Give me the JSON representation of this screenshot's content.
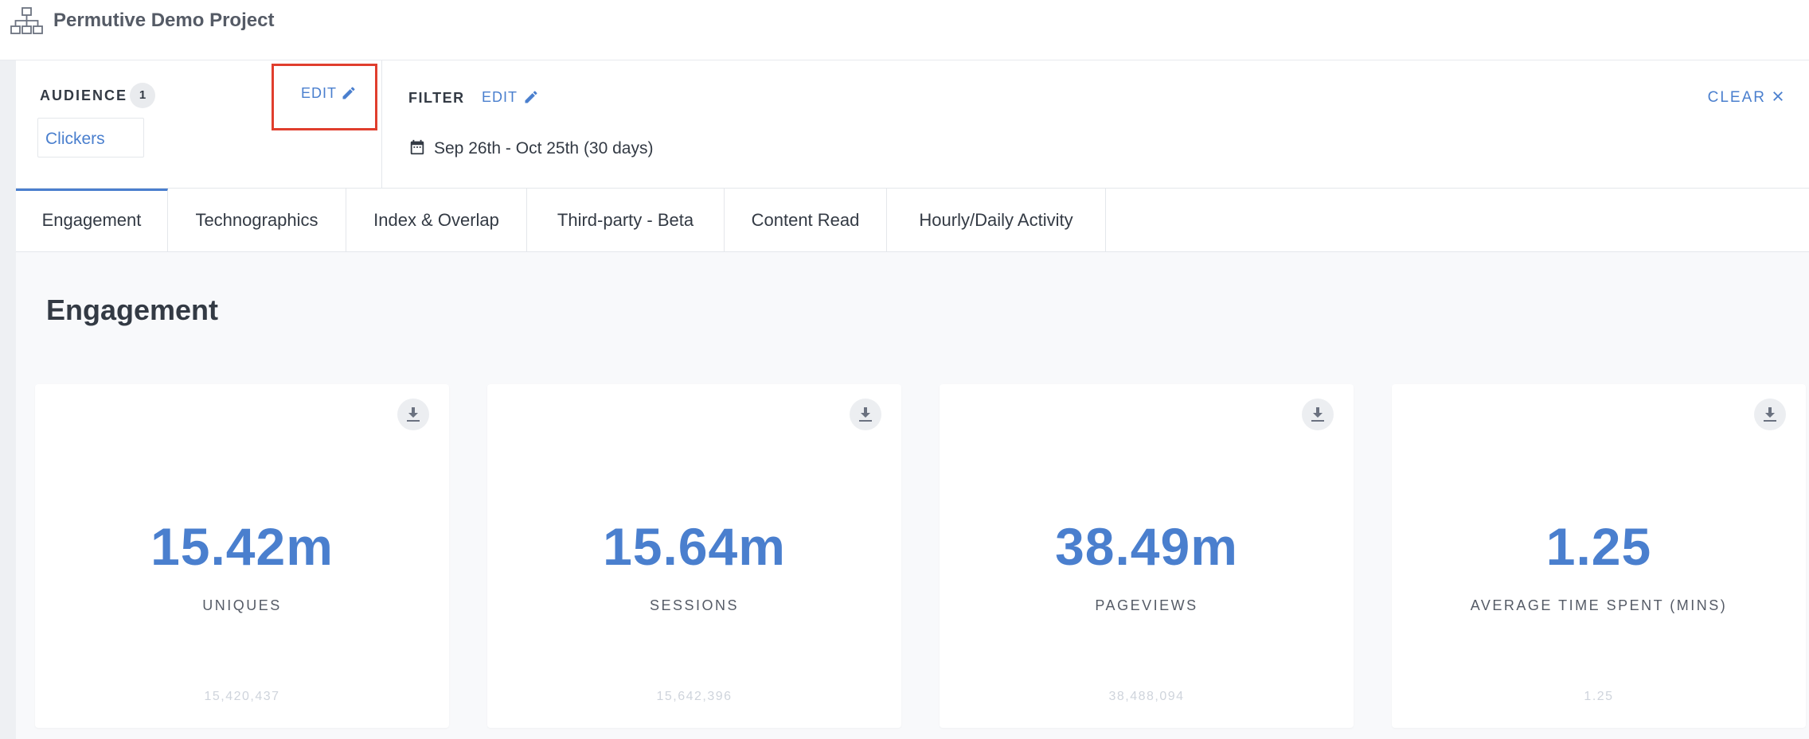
{
  "header": {
    "project_title": "Permutive Demo Project",
    "project_icon": "org-chart-icon"
  },
  "audience": {
    "label": "AUDIENCE",
    "count": "1",
    "edit_label": "EDIT",
    "selected": "Clickers"
  },
  "filter": {
    "label": "FILTER",
    "edit_label": "EDIT",
    "date_range": "Sep 26th - Oct 25th (30 days)",
    "clear_label": "CLEAR"
  },
  "tabs": [
    {
      "label": "Engagement",
      "active": true
    },
    {
      "label": "Technographics",
      "active": false
    },
    {
      "label": "Index & Overlap",
      "active": false
    },
    {
      "label": "Third-party - Beta",
      "active": false
    },
    {
      "label": "Content Read",
      "active": false
    },
    {
      "label": "Hourly/Daily Activity",
      "active": false
    }
  ],
  "section": {
    "title": "Engagement"
  },
  "cards": [
    {
      "value": "15.42m",
      "metric": "UNIQUES",
      "exact": "15,420,437"
    },
    {
      "value": "15.64m",
      "metric": "SESSIONS",
      "exact": "15,642,396"
    },
    {
      "value": "38.49m",
      "metric": "PAGEVIEWS",
      "exact": "38,488,094"
    },
    {
      "value": "1.25",
      "metric": "AVERAGE TIME SPENT (MINS)",
      "exact": "1.25"
    }
  ],
  "colors": {
    "accent": "#4a7fce",
    "highlight": "#e03e2d",
    "text": "#333a44",
    "muted": "#cfd4dc"
  }
}
